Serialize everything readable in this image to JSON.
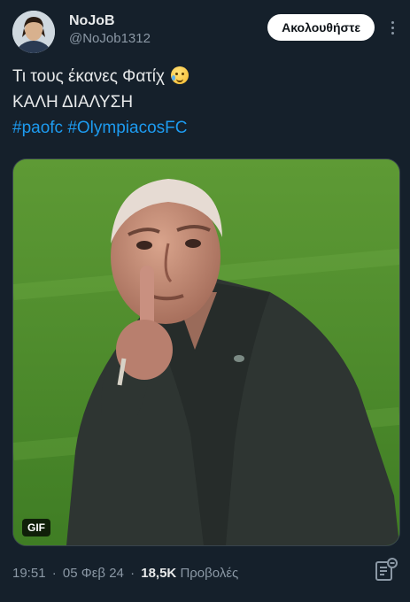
{
  "header": {
    "display_name": "NoJoB",
    "handle": "@NoJob1312",
    "follow_label": "Ακολουθήστε"
  },
  "tweet": {
    "line1": "Τι τους έκανες Φατίχ",
    "line1_emoji": "face-holding-back-tears",
    "line2": "ΚΑΛΗ ΔΙΑΛΥΣΗ",
    "hashtags": [
      "#paofc",
      "#OlympiacosFC"
    ]
  },
  "media": {
    "badge": "GIF"
  },
  "meta": {
    "time": "19:51",
    "separator": "·",
    "date": "05 Φεβ 24",
    "views_count": "18,5K",
    "views_label": "Προβολές"
  },
  "icons": {
    "more": "more-icon",
    "analytics": "analytics-icon"
  },
  "colors": {
    "background": "#15202b",
    "link": "#1d9bf0",
    "muted": "#8b98a5",
    "text": "#e7e9ea"
  }
}
